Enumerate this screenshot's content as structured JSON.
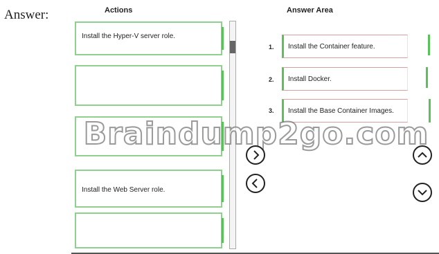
{
  "answer_label": "Answer:",
  "actions": {
    "heading": "Actions",
    "items": [
      {
        "label": "Install the Hyper-V server role."
      },
      {
        "label": ""
      },
      {
        "label": ""
      },
      {
        "label": "Install the Web Server role."
      },
      {
        "label": ""
      }
    ]
  },
  "answer_area": {
    "heading": "Answer Area",
    "items": [
      {
        "number": "1.",
        "label": "Install the Container feature."
      },
      {
        "number": "2.",
        "label": "Install Docker."
      },
      {
        "number": "3.",
        "label": "Install the Base Container Images."
      }
    ]
  },
  "watermark": "Braindump2go.com",
  "colors": {
    "accent_green": "#58c258",
    "border_red": "#d9a0a0"
  },
  "icons": {
    "move_right": "chevron-right-icon",
    "move_left": "chevron-left-icon",
    "move_up": "chevron-up-icon",
    "move_down": "chevron-down-icon"
  }
}
